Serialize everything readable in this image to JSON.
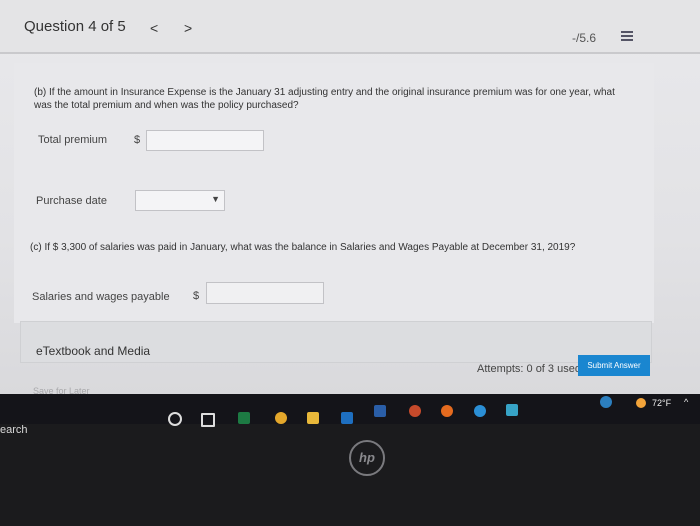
{
  "header": {
    "question_title": "Question 4 of 5",
    "prev_symbol": "<",
    "next_symbol": ">",
    "score": "-/5.6"
  },
  "part_b": {
    "question": "(b) If the amount in Insurance Expense is the January 31 adjusting entry and the original insurance premium was for one year, what was the total premium and when was the policy purchased?",
    "total_premium_label": "Total premium",
    "total_currency": "$",
    "total_premium_value": "",
    "purchase_date_label": "Purchase date",
    "purchase_date_value": ""
  },
  "part_c": {
    "question": "(c) If $ 3,300 of salaries was paid in January, what was the balance in Salaries and Wages Payable at December 31, 2019?",
    "salaries_label": "Salaries and wages payable",
    "currency": "$",
    "salaries_value": ""
  },
  "footer": {
    "etextbook": "eTextbook and Media",
    "save_later": "Save for Later",
    "attempts": "Attempts: 0 of 3 used",
    "submit": "Submit Answer"
  },
  "taskbar": {
    "temperature": "72°F",
    "tray_caret": "^",
    "icons": [
      "cortana-icon",
      "task-view-icon",
      "excel-icon",
      "chrome-icon",
      "file-explorer-icon",
      "outlook-icon",
      "word-icon",
      "powerpoint-icon",
      "firefox-icon",
      "edge-icon",
      "app-icon"
    ]
  },
  "bezel": {
    "search_fragment": "earch",
    "brand": "hp"
  },
  "colors": {
    "submit_bg": "#1a86d0",
    "taskbar_bg": "#141419",
    "bezel_bg": "#1b1b1d"
  }
}
